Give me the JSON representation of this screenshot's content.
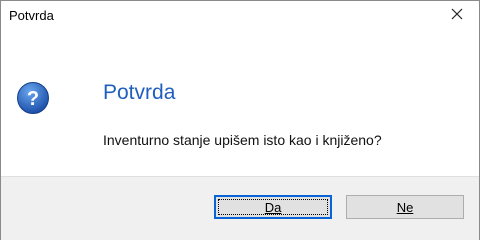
{
  "window": {
    "title": "Potvrda",
    "close_glyph": "✕"
  },
  "dialog": {
    "icon": "question-icon",
    "heading": "Potvrda",
    "message": "Inventurno stanje upišem isto kao i knjiženo?"
  },
  "buttons": {
    "yes_label": "Da",
    "no_label": "Ne"
  },
  "colors": {
    "heading": "#1f5fbf",
    "icon_blue": "#1f5fbf",
    "footer_bg": "#f0f0f0",
    "default_button_border": "#0a64d8"
  }
}
